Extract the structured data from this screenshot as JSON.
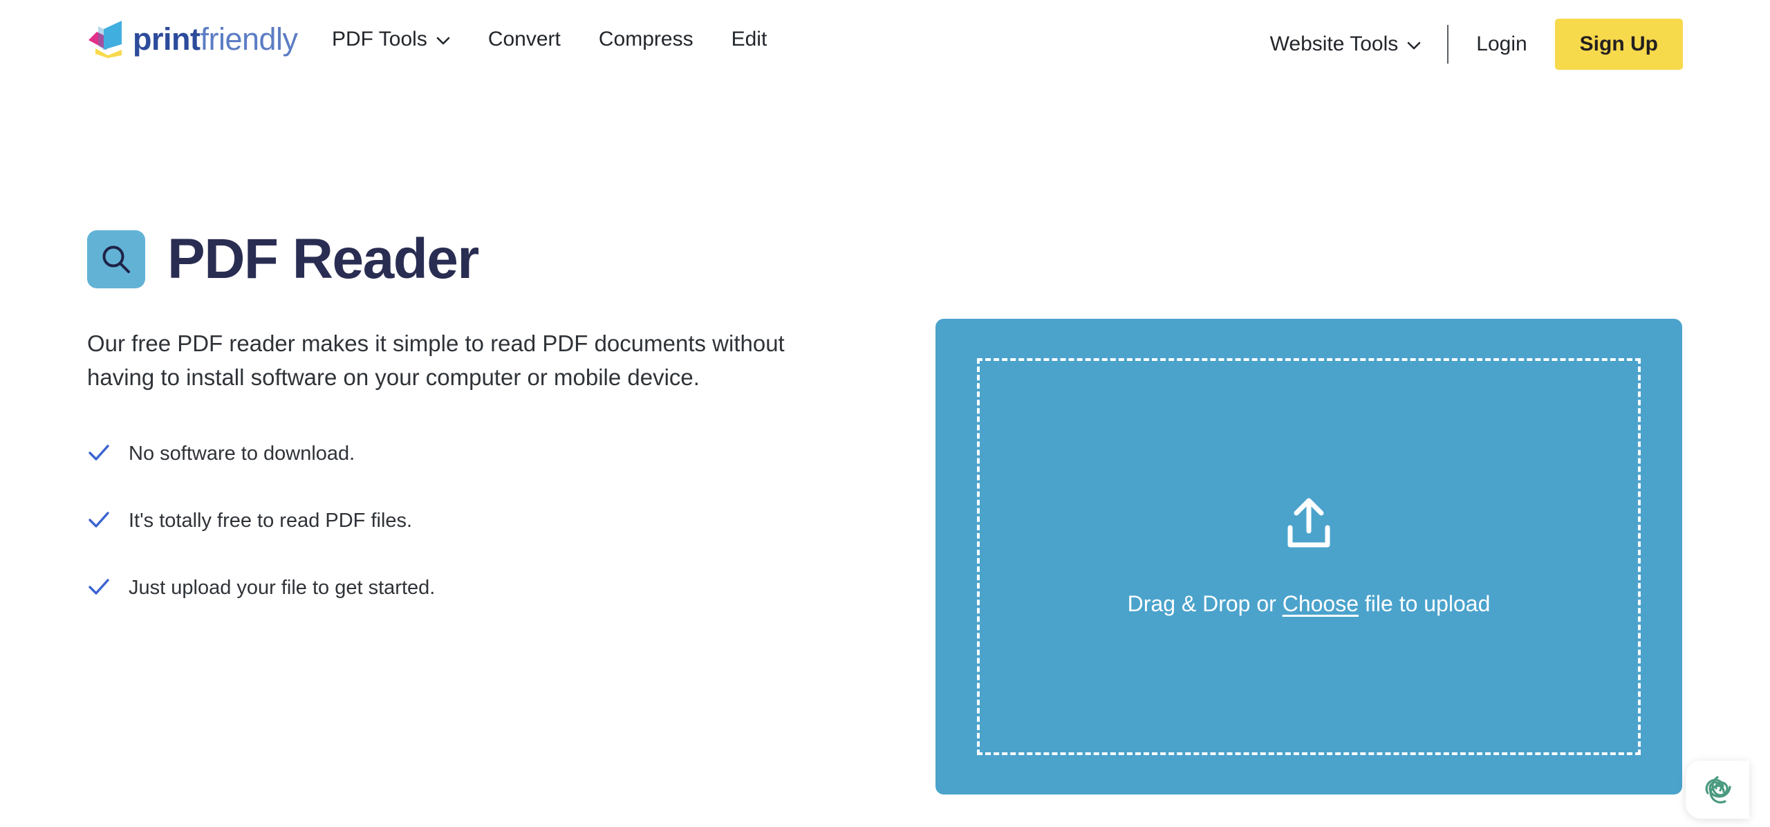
{
  "brand": {
    "name_bold": "print",
    "name_light": "friendly",
    "logo_icon": "printfriendly-logo-icon",
    "colors": {
      "bold_blue": "#2C4B9B",
      "light_blue": "#5C7CC4",
      "logo_cyan": "#41AEE0",
      "logo_magenta": "#E0318B",
      "logo_yellow": "#F7D94C"
    }
  },
  "header": {
    "nav": [
      {
        "label": "PDF Tools",
        "has_dropdown": true,
        "icon": "chevron-down-icon"
      },
      {
        "label": "Convert",
        "has_dropdown": false
      },
      {
        "label": "Compress",
        "has_dropdown": false
      },
      {
        "label": "Edit",
        "has_dropdown": false
      }
    ],
    "website_tools": {
      "label": "Website Tools",
      "has_dropdown": true,
      "icon": "chevron-down-icon"
    },
    "login_label": "Login",
    "signup_label": "Sign Up",
    "signup_bg": "#F7D94C",
    "signup_text_color": "#231F20"
  },
  "hero": {
    "title": "PDF Reader",
    "title_icon": "search-icon",
    "title_icon_bg": "#62B2D6",
    "title_color": "#2A2D52",
    "description": "Our free PDF reader makes it simple to read PDF documents without having to install software on your computer or mobile device.",
    "features": [
      {
        "icon": "check-icon",
        "text": "No software to download."
      },
      {
        "icon": "check-icon",
        "text": "It's totally free to read PDF files."
      },
      {
        "icon": "check-icon",
        "text": "Just upload your file to get started."
      }
    ],
    "check_color": "#3B63D0"
  },
  "upload": {
    "icon": "upload-icon",
    "panel_bg": "#4BA3CC",
    "text_before": "Drag & Drop or ",
    "choose_label": "Choose",
    "text_after": " file to upload"
  },
  "chat_widget": {
    "icon": "chat-knot-icon",
    "color": "#4A9A7E"
  }
}
